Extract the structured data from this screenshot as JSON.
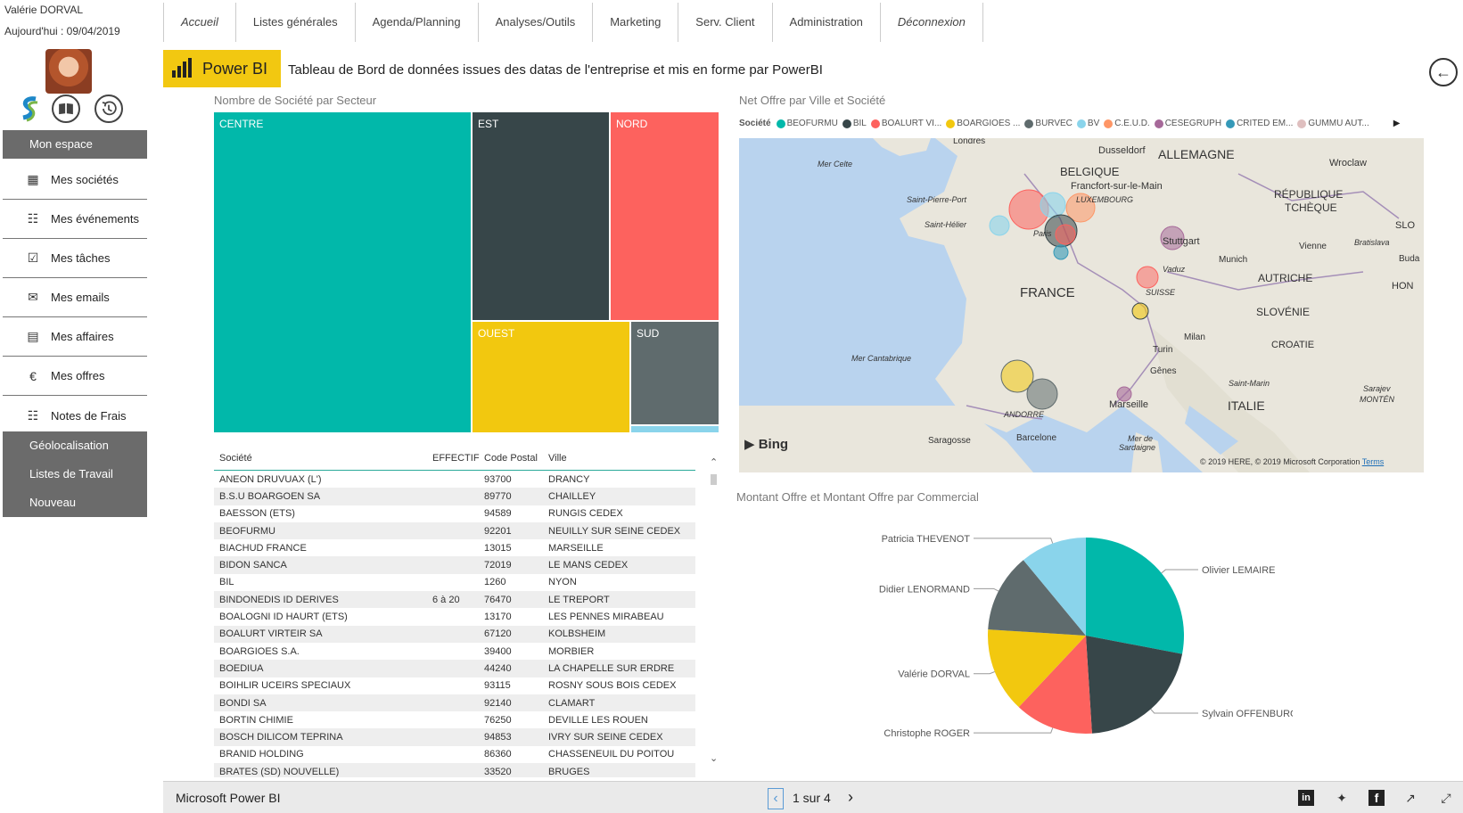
{
  "user": {
    "name": "Valérie DORVAL",
    "date": "Aujourd'hui : 09/04/2019"
  },
  "sidebar": {
    "header": "Mon espace",
    "items": [
      {
        "label": "Mes sociétés",
        "icon": "building-icon"
      },
      {
        "label": "Mes événements",
        "icon": "calendar-icon"
      },
      {
        "label": "Mes tâches",
        "icon": "checklist-icon"
      },
      {
        "label": "Mes emails",
        "icon": "envelope-icon"
      },
      {
        "label": "Mes affaires",
        "icon": "briefcase-icon"
      },
      {
        "label": "Mes offres",
        "icon": "euro-icon"
      },
      {
        "label": "Notes de Frais",
        "icon": "document-icon"
      }
    ],
    "bottom": [
      "Géolocalisation",
      "Listes de Travail",
      "Nouveau"
    ]
  },
  "nav": {
    "tabs": [
      "Accueil",
      "Listes générales",
      "Agenda/Planning",
      "Analyses/Outils",
      "Marketing",
      "Serv. Client",
      "Administration",
      "Déconnexion"
    ]
  },
  "banner": {
    "logo_text": "Power BI",
    "title": "Tableau de Bord de données issues des datas de l'entreprise et mis en forme par PowerBI"
  },
  "treemap": {
    "title": "Nombre de Société par Secteur",
    "cells": [
      "CENTRE",
      "EST",
      "NORD",
      "OUEST",
      "SUD"
    ]
  },
  "table": {
    "headers": [
      "Société",
      "EFFECTIF",
      "Code Postal",
      "Ville"
    ],
    "rows": [
      [
        "ANEON DRUVUAX (L')",
        "",
        "93700",
        "DRANCY"
      ],
      [
        "B.S.U BOARGOEN SA",
        "",
        "89770",
        "CHAILLEY"
      ],
      [
        "BAESSON (ETS)",
        "",
        "94589",
        "RUNGIS CEDEX"
      ],
      [
        "BEOFURMU",
        "",
        "92201",
        "NEUILLY SUR SEINE CEDEX"
      ],
      [
        "BIACHUD FRANCE",
        "",
        "13015",
        "MARSEILLE"
      ],
      [
        "BIDON SANCA",
        "",
        "72019",
        "LE MANS CEDEX"
      ],
      [
        "BIL",
        "",
        "1260",
        "NYON"
      ],
      [
        "BINDONEDIS ID DERIVES",
        "6 à 20",
        "76470",
        "LE TREPORT"
      ],
      [
        "BOALOGNI ID HAURT (ETS)",
        "",
        "13170",
        "LES PENNES MIRABEAU"
      ],
      [
        "BOALURT VIRTEIR SA",
        "",
        "67120",
        "KOLBSHEIM"
      ],
      [
        "BOARGIOES S.A.",
        "",
        "39400",
        "MORBIER"
      ],
      [
        "BOEDIUA",
        "",
        "44240",
        "LA CHAPELLE SUR ERDRE"
      ],
      [
        "BOIHLIR UCEIRS SPECIAUX",
        "",
        "93115",
        "ROSNY SOUS BOIS CEDEX"
      ],
      [
        "BONDI SA",
        "",
        "92140",
        "CLAMART"
      ],
      [
        "BORTIN CHIMIE",
        "",
        "76250",
        "DEVILLE LES ROUEN"
      ],
      [
        "BOSCH DILICOM TEPRINA",
        "",
        "94853",
        "IVRY SUR SEINE CEDEX"
      ],
      [
        "BRANID HOLDING",
        "",
        "86360",
        "CHASSENEUIL DU POITOU"
      ],
      [
        "BRATES (SD) NOUVELLE)",
        "",
        "33520",
        "BRUGES"
      ]
    ]
  },
  "map": {
    "title": "Net Offre par Ville et Société",
    "legend_label": "Société",
    "legend": [
      {
        "name": "BEOFURMU",
        "color": "#01b8aa"
      },
      {
        "name": "BIL",
        "color": "#374649"
      },
      {
        "name": "BOALURT VI...",
        "color": "#fd625e"
      },
      {
        "name": "BOARGIOES ...",
        "color": "#f2c80f"
      },
      {
        "name": "BURVEC",
        "color": "#5f6b6d"
      },
      {
        "name": "BV",
        "color": "#8ad4eb"
      },
      {
        "name": "C.E.U.D.",
        "color": "#fe9666"
      },
      {
        "name": "CESEGRUPH",
        "color": "#a66999"
      },
      {
        "name": "CRITED EM...",
        "color": "#3599b8"
      },
      {
        "name": "GUMMU AUT...",
        "color": "#dfbfbf"
      }
    ],
    "labels": [
      "Londres",
      "Dusseldorf",
      "ALLEMAGNE",
      "BELGIQUE",
      "Francfort-sur-le-Main",
      "LUXEMBOURG",
      "Wroclaw",
      "RÉPUBLIQUE",
      "TCHÈQUE",
      "Mer Celte",
      "Saint-Pierre-Port",
      "Saint-Hélier",
      "Paris",
      "Stuttgart",
      "Vienne",
      "Bratislava",
      "SLO",
      "Munich",
      "Buda",
      "Vaduz",
      "AUTRICHE",
      "HON",
      "SUISSE",
      "FRANCE",
      "SLOVÉNIE",
      "CROATIE",
      "Turin",
      "Milan",
      "Mer Cantabrique",
      "Gênes",
      "Saint-Marin",
      "Sarajev",
      "MONTÉN",
      "ITALIE",
      "ANDORRE",
      "Marseille",
      "Saragosse",
      "Barcelone",
      "Mer de",
      "Sardaigne"
    ],
    "bing": "Bing",
    "copyright": "© 2019 HERE, © 2019 Microsoft Corporation",
    "terms": "Terms"
  },
  "pie": {
    "title": "Montant Offre et Montant Offre par Commercial"
  },
  "chart_data": {
    "type": "pie",
    "title": "Montant Offre et Montant Offre par Commercial",
    "categories": [
      "Olivier LEMAIRE",
      "Sylvain OFFENBURG",
      "Christophe ROGER",
      "Valérie DORVAL",
      "Didier LENORMAND",
      "Patricia THEVENOT"
    ],
    "values": [
      28,
      21,
      13,
      14,
      13,
      11
    ],
    "colors": [
      "#01b8aa",
      "#374649",
      "#fd625e",
      "#f2c80f",
      "#5f6b6d",
      "#8ad4eb"
    ]
  },
  "footer": {
    "brand": "Microsoft Power BI",
    "page": "1 sur 4"
  }
}
